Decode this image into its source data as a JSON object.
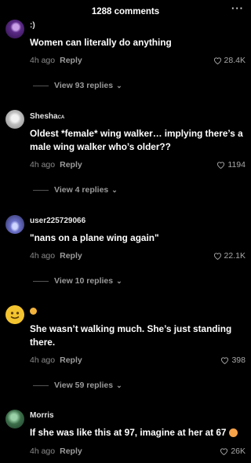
{
  "header": {
    "title": "1288 comments",
    "more_icon": "more-horizontal-icon"
  },
  "comments": [
    {
      "username": ":)",
      "text": "Women can literally do anything",
      "time": "4h ago",
      "reply": "Reply",
      "likes": "28.4K",
      "view_replies": "View 93 replies",
      "avatar_color": "#5b2a86"
    },
    {
      "username": "Shesha",
      "username_suffix": "CA",
      "text": "Oldest *female* wing walker… implying there’s a male wing walker who’s older??",
      "time": "4h ago",
      "reply": "Reply",
      "likes": "1194",
      "view_replies": "View 4 replies",
      "avatar_color": "#cfcfcf"
    },
    {
      "username": "user225729066",
      "text": "\"nans on a plane wing again\"",
      "time": "4h ago",
      "reply": "Reply",
      "likes": "22.1K",
      "view_replies": "View 10 replies",
      "avatar_color": "#4b4f8a"
    },
    {
      "username": "",
      "username_emoji": "face-emoji",
      "text": "She wasn’t walking much. She’s just standing there.",
      "time": "4h ago",
      "reply": "Reply",
      "likes": "398",
      "view_replies": "View 59 replies",
      "avatar_color": "#f4c430"
    },
    {
      "username": "Morris",
      "text": "If she was like this at 97, imagine at her at 67",
      "text_emoji": "flushed-face-emoji",
      "time": "4h ago",
      "reply": "Reply",
      "likes": "26K",
      "avatar_color": "#3c6e4a"
    }
  ]
}
